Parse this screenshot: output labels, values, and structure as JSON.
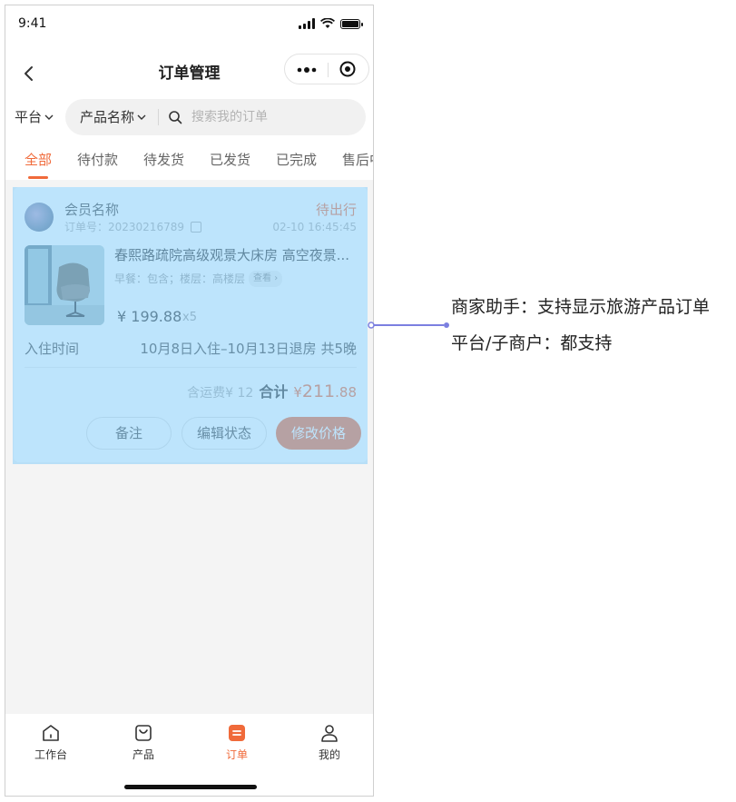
{
  "status_bar": {
    "time": "9:41"
  },
  "nav": {
    "title": "订单管理"
  },
  "filters": {
    "platform": "平台",
    "product": "产品名称",
    "search_placeholder": "搜索我的订单"
  },
  "tabs": [
    {
      "label": "全部",
      "active": true
    },
    {
      "label": "待付款"
    },
    {
      "label": "待发货"
    },
    {
      "label": "已发货"
    },
    {
      "label": "已完成"
    },
    {
      "label": "售后中"
    }
  ],
  "order": {
    "member_name": "会员名称",
    "order_no": "订单号：20230216789",
    "status": "待出行",
    "time": "02-10 16:45:45",
    "product_title": "春熙路疏院高级观景大床房 高空夜景...",
    "meta": "早餐：包含；楼层：高楼层",
    "meta_link": "查看",
    "price": "¥ 199.88",
    "qty": "x5",
    "stay_label": "入住时间",
    "stay_value": "10月8日入住–10月13日退房  共5晚",
    "shipping": "含运费¥ 12",
    "total_label": "合计",
    "total_amount_prefix": "¥",
    "total_amount_int": "211",
    "total_amount_dec": ".88",
    "buttons": [
      "备注",
      "编辑状态",
      "修改价格"
    ]
  },
  "tabbar": [
    {
      "label": "工作台",
      "icon": "home-icon"
    },
    {
      "label": "产品",
      "icon": "bag-icon"
    },
    {
      "label": "订单",
      "icon": "order-icon",
      "active": true
    },
    {
      "label": "我的",
      "icon": "user-icon"
    }
  ],
  "annotation": {
    "line1": "商家助手：支持显示旅游产品订单",
    "line2": "平台/子商户：都支持"
  },
  "colors": {
    "accent": "#f06a3a",
    "highlight": "#87cefa",
    "connector": "#7b7fe0"
  }
}
